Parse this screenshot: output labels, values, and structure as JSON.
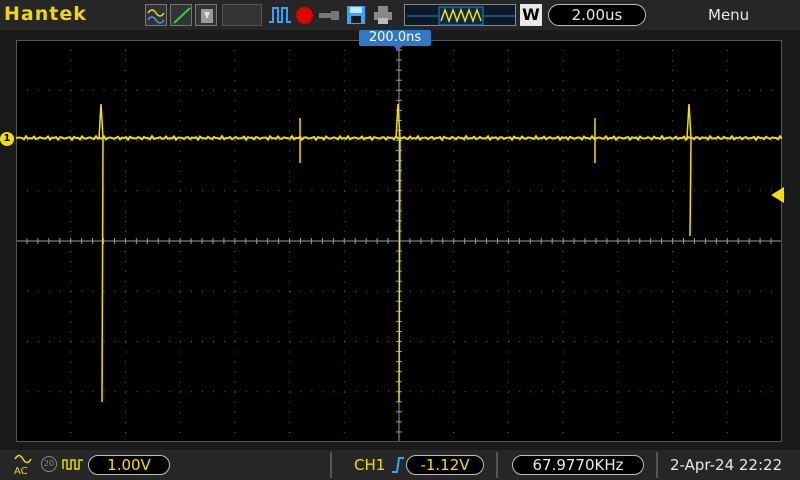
{
  "header": {
    "brand": "Hantek",
    "timebase": "2.00us",
    "menu_label": "Menu",
    "w_button": "W"
  },
  "screen": {
    "trigger_position": "200.0ns",
    "channel_marker": "1",
    "trace_color": "#f0e000",
    "grid_color": "#6a6a6a"
  },
  "footer": {
    "coupling": "AC",
    "bandwidth_limit": "20",
    "volts_per_div": "1.00V",
    "trigger_source": "CH1",
    "trigger_level": "-1.12V",
    "frequency": "67.9770KHz",
    "datetime": "2-Apr-24 22:22"
  },
  "icons": [
    "wave-display-icon",
    "line-display-icon",
    "persist-icon",
    "run-icon",
    "record-icon",
    "usb-icon",
    "save-icon",
    "print-icon",
    "waveform-overview-icon",
    "edge-trigger-icon"
  ]
}
